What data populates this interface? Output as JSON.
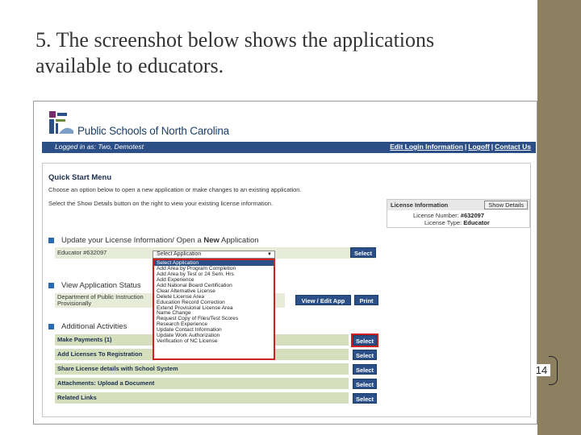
{
  "slide": {
    "title_line1": "5. The screenshot below shows the applications",
    "title_line2": "available to educators.",
    "page_number": "14"
  },
  "app": {
    "site_name": "Public Schools of North Carolina",
    "logged_in": "Logged in as: Two, Demotest",
    "nav_links": [
      "Edit Login Information",
      "Logoff",
      "Contact Us"
    ]
  },
  "quick_start": {
    "title": "Quick Start Menu",
    "line1": "Choose an option below to open a new application or make changes to an existing application.",
    "line2": "Select the Show Details button on the right to view your existing license information."
  },
  "license_info": {
    "heading": "License Information",
    "show_details": "Show Details",
    "number_label": "License Number:",
    "number_value": "#632097",
    "type_label": "License Type:",
    "type_value": "Educator"
  },
  "update_section": {
    "heading_prefix": "Update your License Information/ Open a ",
    "heading_bold": "New",
    "heading_suffix": " Application",
    "row_label": "Educator #632097",
    "select_value": "Select Application",
    "select_button": "Select"
  },
  "dropdown": {
    "options": [
      "Select Application",
      "Add Area by Program Completion",
      "Add Area by Test or 24 Sem. Hrs",
      "Add Experience",
      "Add National Board Certification",
      "Clear Alternative License",
      "Delete License Area",
      "Education Record Correction",
      "Extend Provisional License Area",
      "Name Change",
      "Request Copy of Files/Test Scores",
      "Research Experience",
      "Update Contact Information",
      "Update Work Authorization",
      "Verification of NC License"
    ]
  },
  "view_status": {
    "heading": "View Application Status",
    "row_line1": "Department of Public Instruction",
    "row_line2": "Provisionally",
    "view_button": "View / Edit App",
    "print_button": "Print"
  },
  "additional": {
    "heading": "Additional Activities",
    "rows": [
      {
        "label": "Make Payments (1)",
        "button": "Select"
      },
      {
        "label": "Add Licenses To Registration",
        "button": "Select"
      },
      {
        "label": "Share License details with School System",
        "button": "Select"
      },
      {
        "label": "Attachments: Upload a Document",
        "button": "Select"
      },
      {
        "label": "Related Links",
        "button": "Select"
      }
    ]
  },
  "colors": {
    "nav_blue": "#2b4f86",
    "highlight_red": "#d02020",
    "side_bar": "#8c8061",
    "row_green": "#e6ecd8"
  }
}
